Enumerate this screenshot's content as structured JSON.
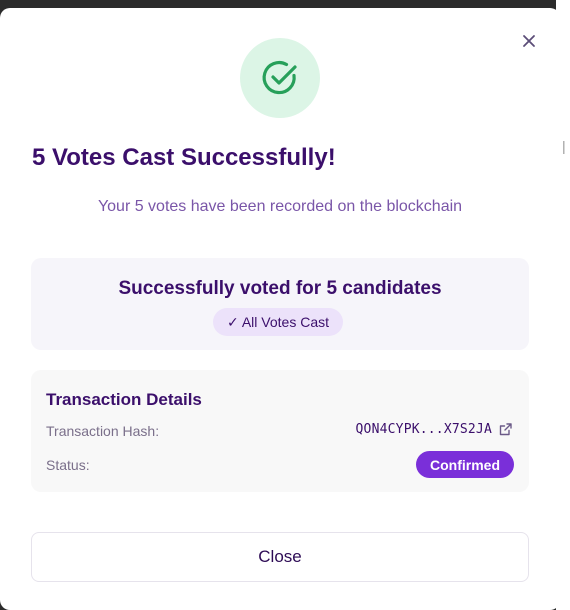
{
  "modal": {
    "close_icon": "close-icon",
    "success_icon": "check-circle-icon",
    "title": "5 Votes Cast Successfully!",
    "subtitle": "Your 5 votes have been recorded on the blockchain"
  },
  "summary": {
    "text": "Successfully voted for 5 candidates",
    "badge": "✓ All Votes Cast"
  },
  "transaction": {
    "heading": "Transaction Details",
    "hash_label": "Transaction Hash:",
    "hash_value": "QON4CYPK...X7S2JA",
    "hash_link_icon": "external-link-icon",
    "status_label": "Status:",
    "status_value": "Confirmed"
  },
  "footer": {
    "close_label": "Close"
  },
  "colors": {
    "title": "#3b0f6b",
    "success_green": "#27a05a",
    "success_bg": "#dcf5e6",
    "status_purple": "#7a2fd9",
    "badge_bg": "#ece2fa"
  }
}
